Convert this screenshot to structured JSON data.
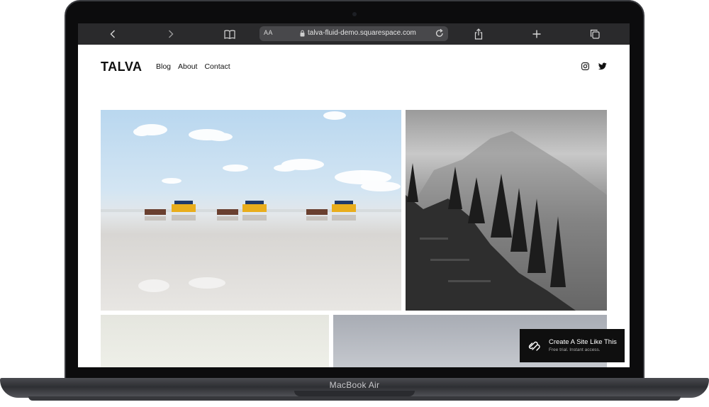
{
  "browser": {
    "url": "talva-fluid-demo.squarespace.com",
    "reader_label": "AA"
  },
  "site": {
    "logo": "TALVA",
    "nav": [
      {
        "label": "Blog"
      },
      {
        "label": "About"
      },
      {
        "label": "Contact"
      }
    ]
  },
  "badge": {
    "title": "Create A Site Like This",
    "subtitle": "Free trial. Instant access."
  },
  "device": {
    "label": "MacBook Air"
  }
}
